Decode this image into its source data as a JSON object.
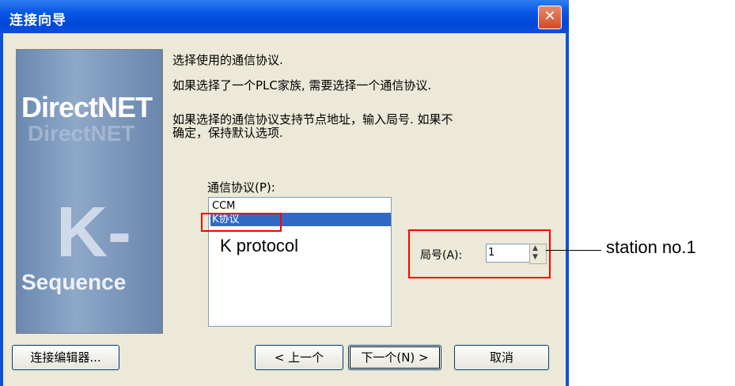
{
  "window": {
    "title": "连接向导",
    "close_glyph": "✕"
  },
  "art": {
    "brand_top": "DirectNET",
    "brand_top_echo": "DirectNET",
    "brand_letter": "K-",
    "brand_bottom": "Sequence"
  },
  "instructions": [
    "选择使用的通信协议.",
    "如果选择了一个PLC家族, 需要选择一个通信协议.",
    "如果选择的通信协议支持节点地址，输入局号. 如果不",
    "确定，保持默认选项."
  ],
  "protocol_list": {
    "label": "通信协议(P):",
    "items": [
      "CCM",
      "K协议"
    ],
    "selected_index": 1
  },
  "annotation": {
    "protocol_caption": "K protocol",
    "station_caption": "station no.1"
  },
  "station": {
    "label": "局号(A):",
    "value": "1"
  },
  "buttons": {
    "editor": "连接编辑器...",
    "back": "< 上一个",
    "next": "下一个(N) >",
    "cancel": "取消"
  },
  "icons": {
    "close": "close-icon",
    "spin": "spinner-arrows-icon"
  }
}
